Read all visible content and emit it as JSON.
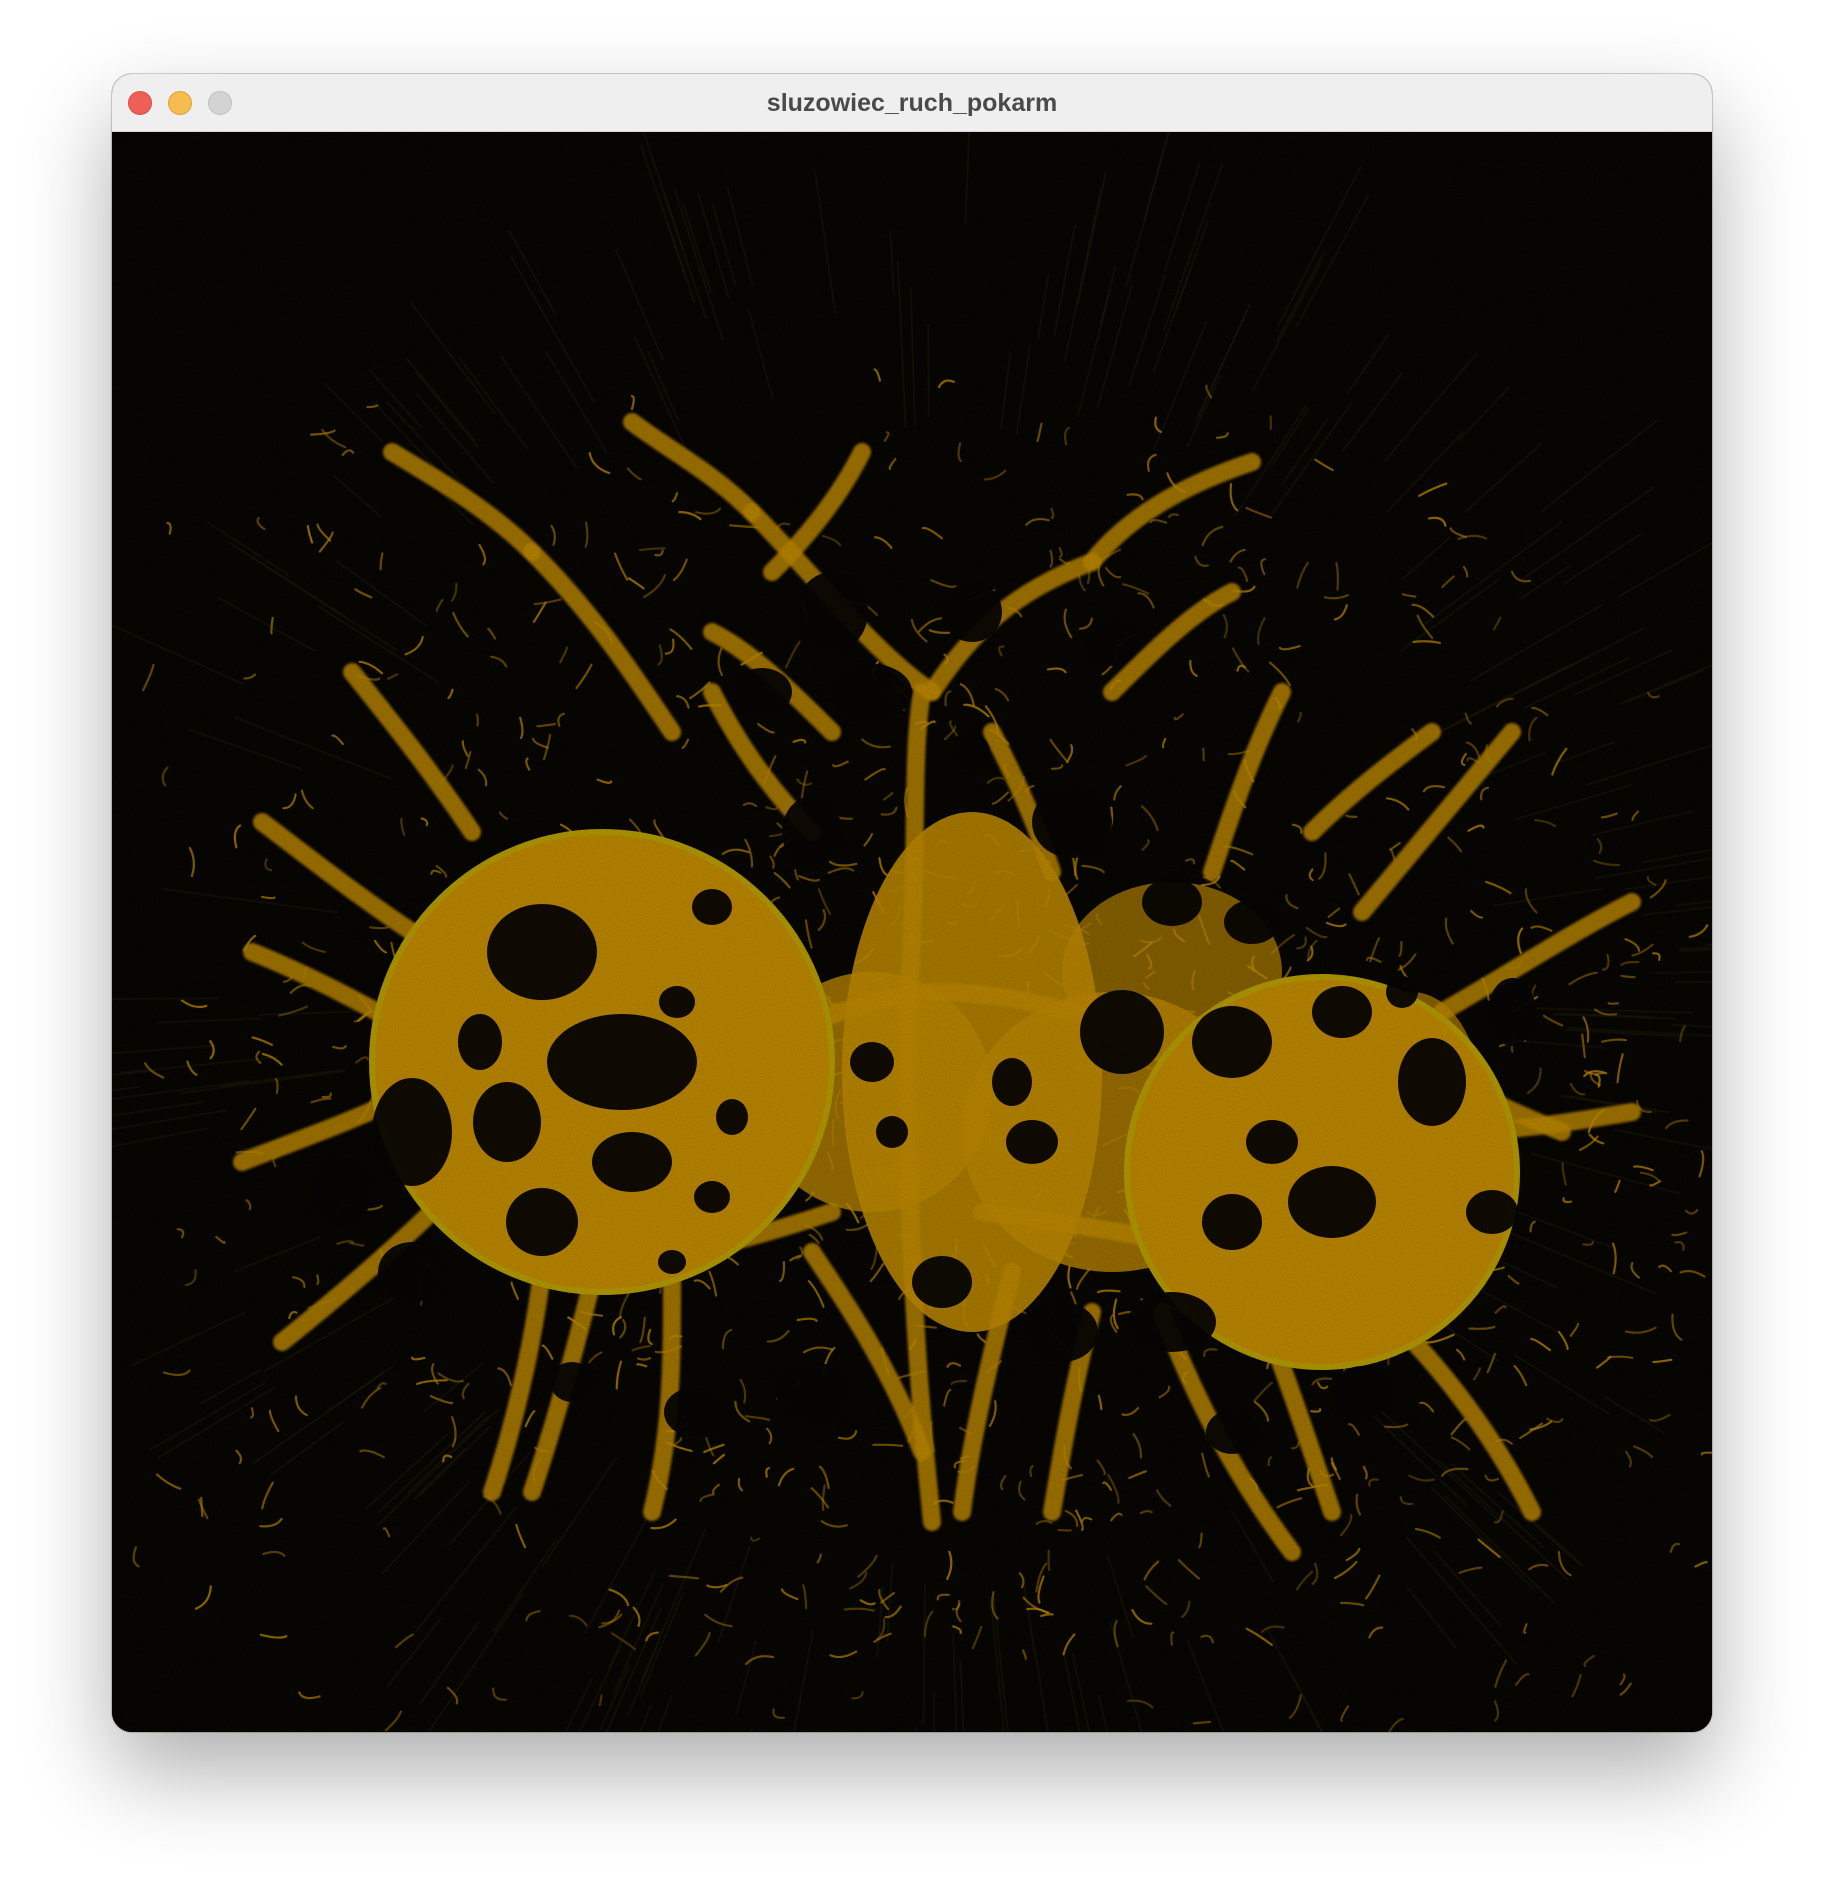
{
  "window": {
    "title": "sluzowiec_ruch_pokarm",
    "buttons": {
      "close": "close-button",
      "minimize": "minimize-button",
      "zoom": "zoom-button"
    }
  },
  "simulation": {
    "background_color": "#050402",
    "slime_color": "#b07f00",
    "food_source_color": "#a89000",
    "description_icon": "slime-mold-network"
  }
}
